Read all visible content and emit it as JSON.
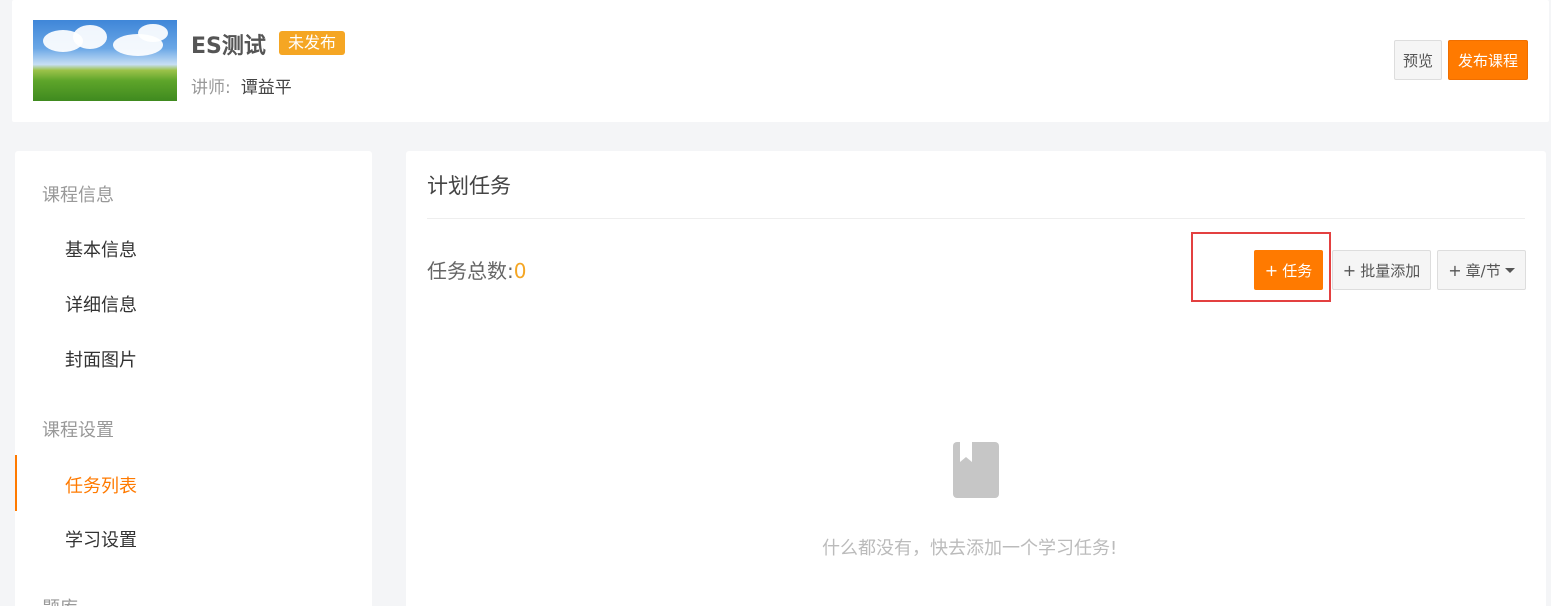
{
  "header": {
    "course_title": "ES测试",
    "status_badge": "未发布",
    "teacher_label": "讲师:",
    "teacher_name": "谭益平",
    "preview_label": "预览",
    "publish_label": "发布课程"
  },
  "sidebar": {
    "group_course_info": "课程信息",
    "items_info": [
      "基本信息",
      "详细信息",
      "封面图片"
    ],
    "group_course_settings": "课程设置",
    "items_settings": [
      "任务列表",
      "学习设置"
    ],
    "active_item": "任务列表",
    "group_bank": "题库"
  },
  "main": {
    "title": "计划任务",
    "total_label": "任务总数:",
    "total_count": "0",
    "add_task_label": "任务",
    "batch_add_label": "批量添加",
    "chapter_label": "章/节",
    "empty_message": "什么都没有，快去添加一个学习任务!"
  },
  "colors": {
    "accent": "#ff7a00",
    "badge": "#f5a623",
    "highlight_border": "#e34040"
  }
}
